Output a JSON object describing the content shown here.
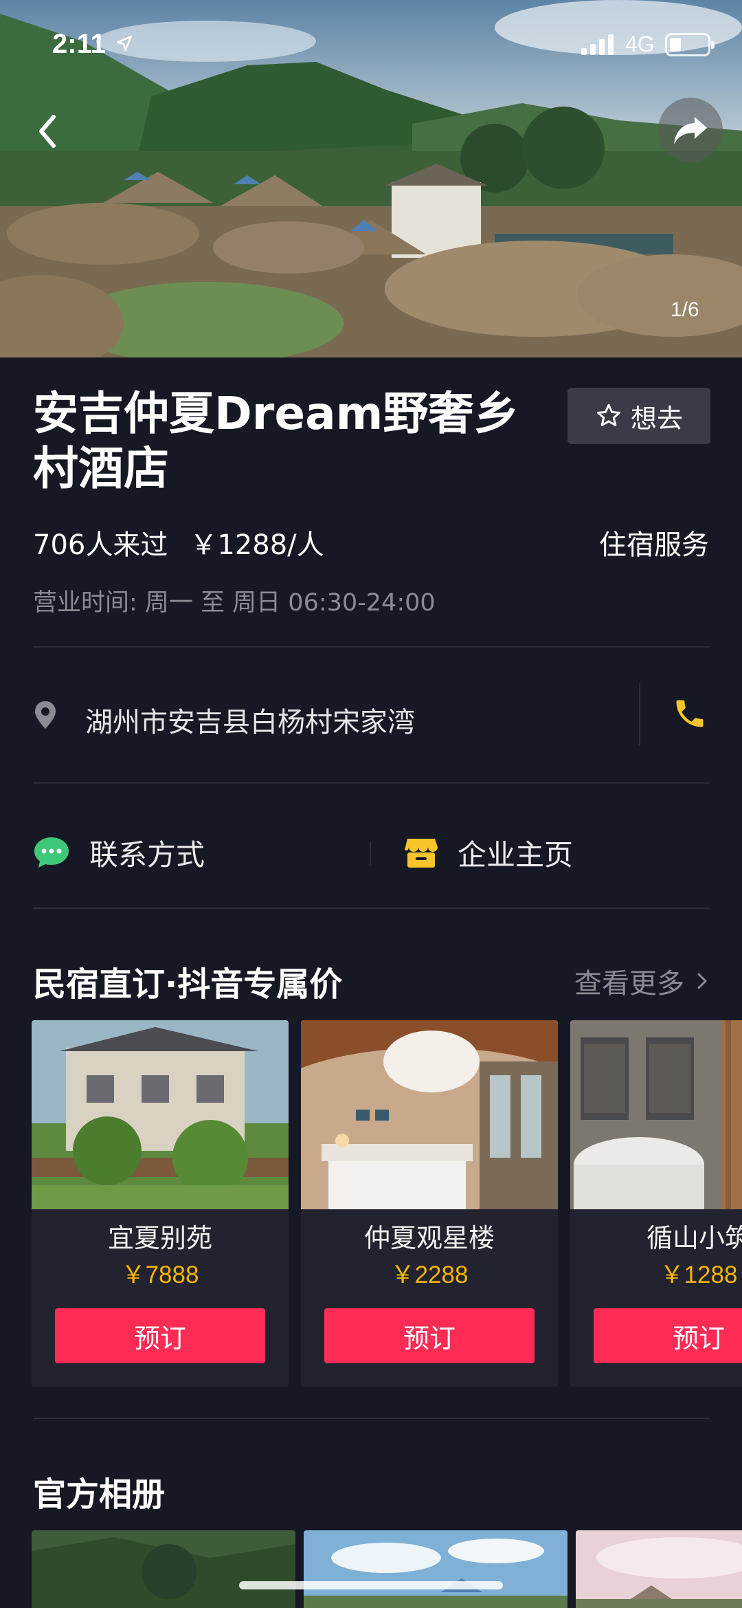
{
  "status_bar": {
    "time": "2:11",
    "network": "4G"
  },
  "hero": {
    "page_indicator": "1/6"
  },
  "poi": {
    "title": "安吉仲夏Dream野奢乡村酒店",
    "want_label": "想去",
    "visitors": "706人来过",
    "price": "￥1288/人",
    "category": "住宿服务",
    "hours": "营业时间: 周一 至 周日  06:30-24:00",
    "address": "湖州市安吉县白杨村宋家湾"
  },
  "links": {
    "contact": "联系方式",
    "company": "企业主页"
  },
  "booking": {
    "title": "民宿直订·抖音专属价",
    "see_more": "查看更多",
    "rooms": [
      {
        "name": "宜夏别苑",
        "price": "￥7888",
        "button": "预订"
      },
      {
        "name": "仲夏观星楼",
        "price": "￥2288",
        "button": "预订"
      },
      {
        "name": "循山小筑",
        "price": "￥1288",
        "button": "预订"
      }
    ]
  },
  "album": {
    "title": "官方相册"
  },
  "colors": {
    "background": "#161823",
    "accent": "#fe2c55",
    "price": "#f7b500",
    "card": "#22232e"
  },
  "icons": [
    "location-arrow-icon",
    "signal-icon",
    "battery-icon",
    "back-arrow-icon",
    "share-icon",
    "star-icon",
    "map-pin-icon",
    "phone-icon",
    "chat-bubble-icon",
    "shop-icon",
    "chevron-right-icon"
  ]
}
